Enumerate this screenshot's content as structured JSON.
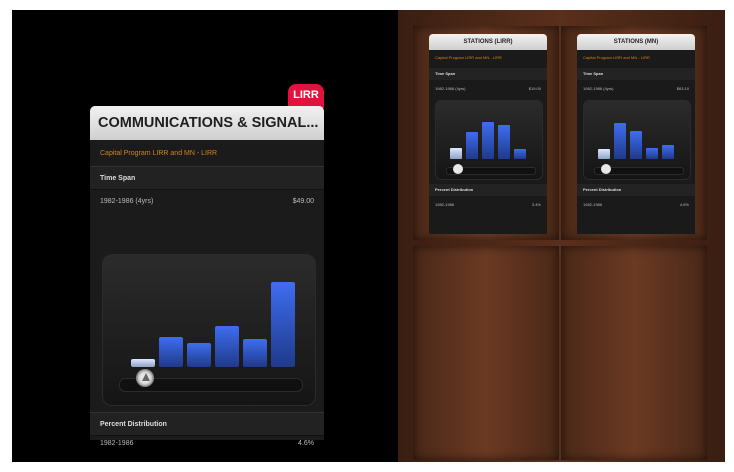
{
  "main_panel": {
    "tag": "LIRR",
    "title": "COMMUNICATIONS & SIGNAL...",
    "subtitle": "Capital Program LIRR and MN - LIRR",
    "time_span_label": "Time Span",
    "time_span_range": "1982-1986 (4yrs)",
    "time_span_value": "$49.00",
    "percent_label": "Percent Distribution",
    "percent_range": "1982-1986",
    "percent_value": "4.6%"
  },
  "mini_panels": [
    {
      "title": "STATIONS (LIRR)",
      "subtitle": "Capital Program LIRR and MN - LIRR",
      "time_span_label": "Time Span",
      "time_span_range": "1982-1986 (4yrs)",
      "time_span_value": "$19.00",
      "percent_label": "Percent Distribution",
      "percent_range": "1982-1986",
      "percent_value": "3.4%"
    },
    {
      "title": "STATIONS (MN)",
      "subtitle": "Capital Program LIRR and MN - LIRR",
      "time_span_label": "Time Span",
      "time_span_range": "1982-1986 (4yrs)",
      "time_span_value": "$63.10",
      "percent_label": "Percent Distribution",
      "percent_range": "1982-1986",
      "percent_value": "4.6%"
    }
  ],
  "main_chart": {
    "bar_values": [
      0.08,
      0.32,
      0.25,
      0.44,
      0.3,
      0.9
    ],
    "selected_index": 0
  },
  "mini_charts": [
    {
      "bar_values": [
        0.22,
        0.56,
        0.78,
        0.7,
        0.2
      ],
      "selected_index": 0
    },
    {
      "bar_values": [
        0.2,
        0.74,
        0.58,
        0.22,
        0.3
      ],
      "selected_index": 0
    }
  ]
}
